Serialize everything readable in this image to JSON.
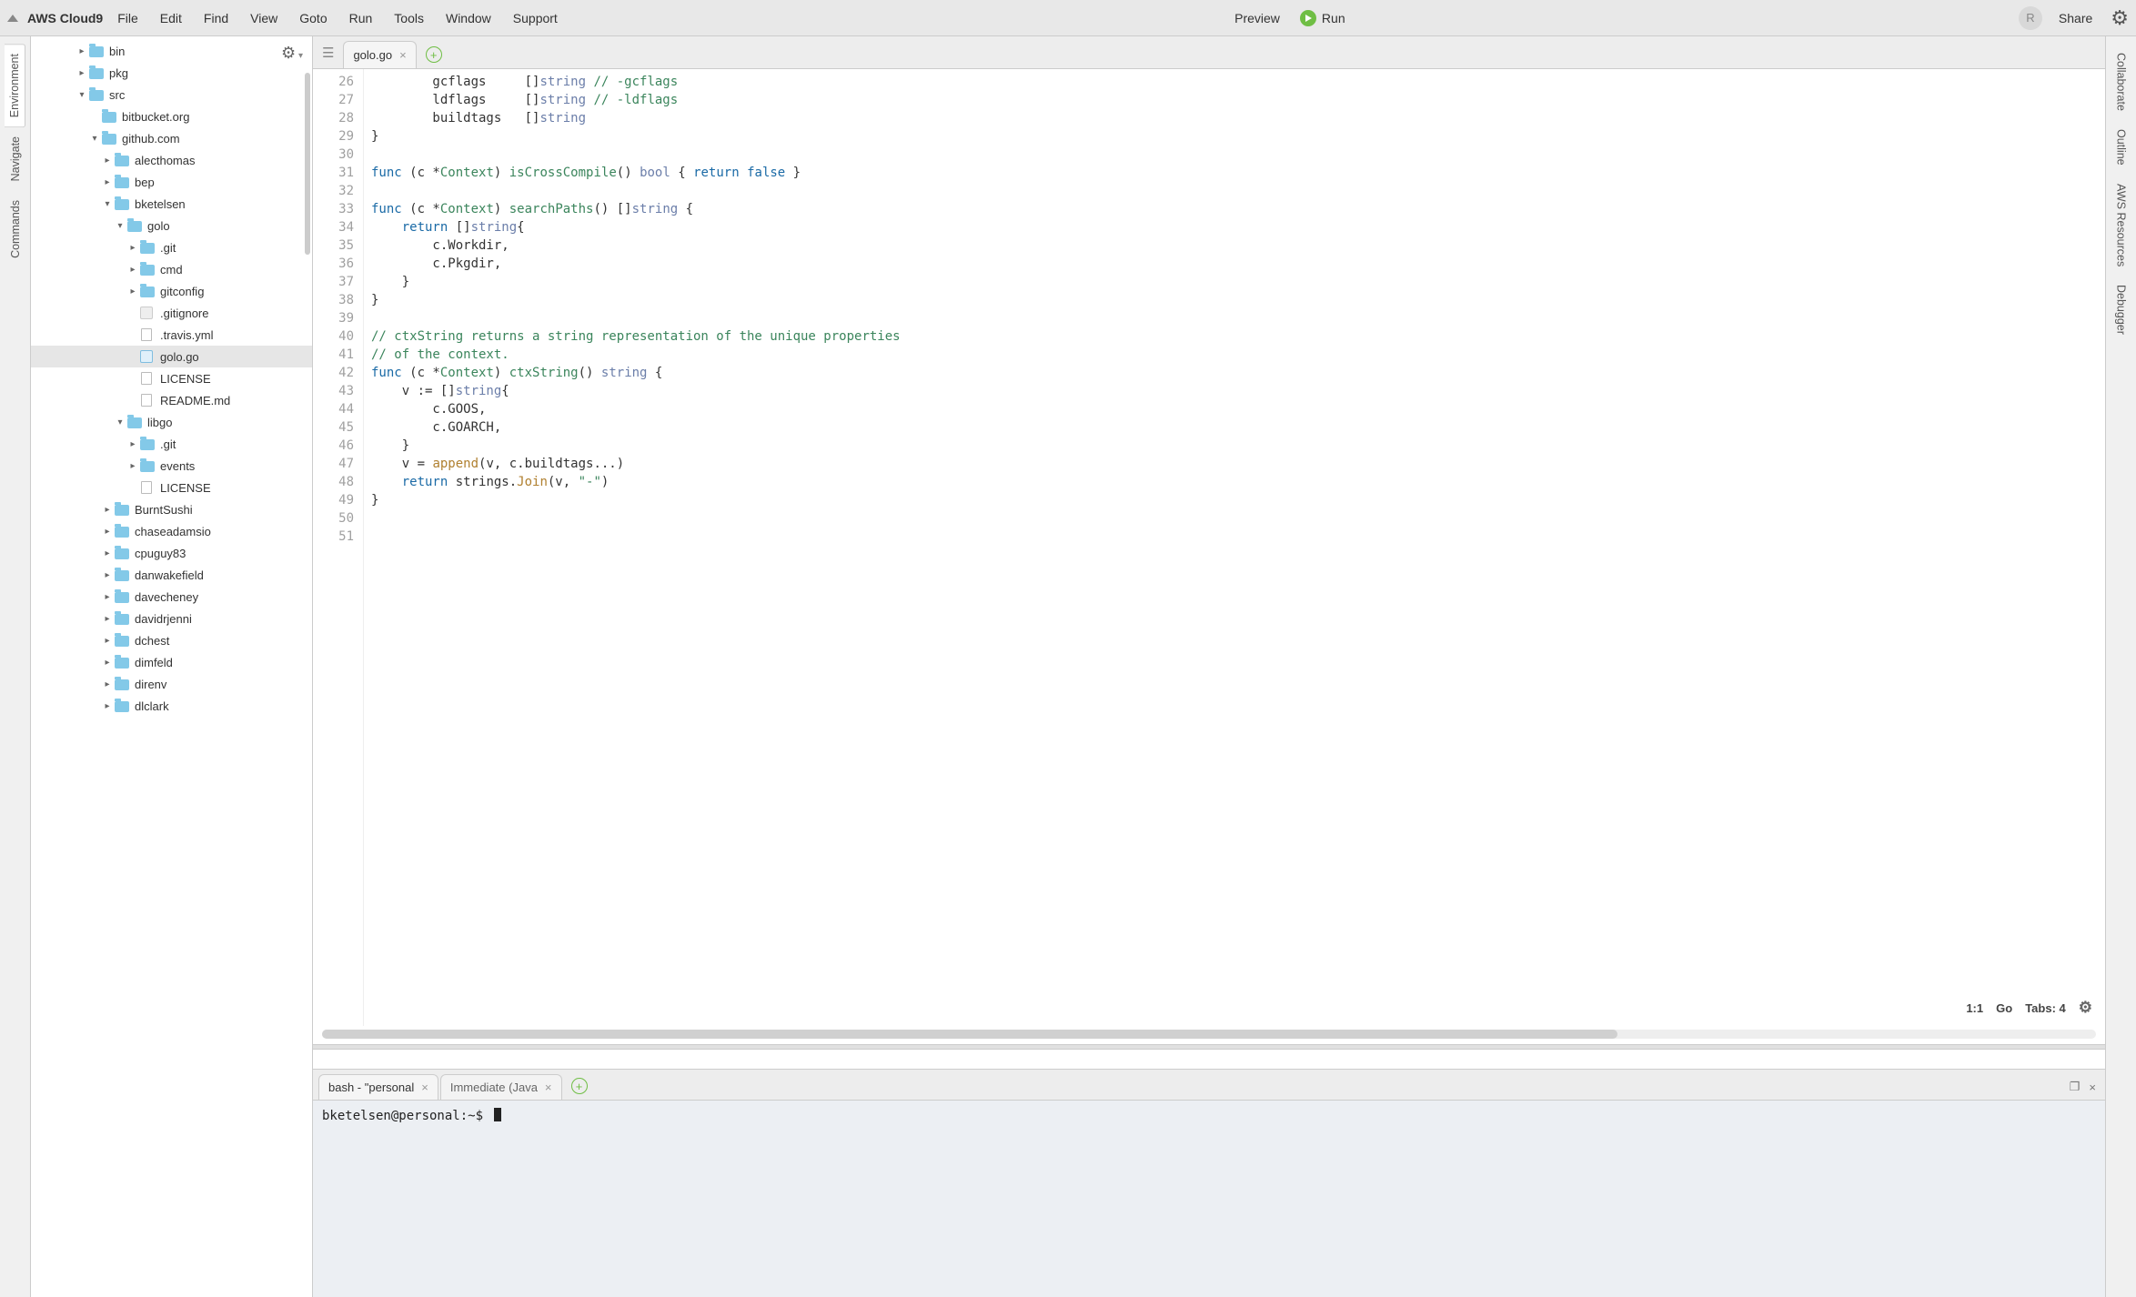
{
  "menubar": {
    "brand": "AWS Cloud9",
    "items": [
      "File",
      "Edit",
      "Find",
      "View",
      "Goto",
      "Run",
      "Tools",
      "Window",
      "Support"
    ],
    "preview": "Preview",
    "run": "Run",
    "avatar_letter": "R",
    "share": "Share"
  },
  "left_rail": [
    "Environment",
    "Navigate",
    "Commands"
  ],
  "right_rail": [
    "Collaborate",
    "Outline",
    "AWS Resources",
    "Debugger"
  ],
  "tree": [
    {
      "depth": 0,
      "type": "folder",
      "chev": "right",
      "label": "bin"
    },
    {
      "depth": 0,
      "type": "folder",
      "chev": "right",
      "label": "pkg"
    },
    {
      "depth": 0,
      "type": "folder",
      "chev": "down",
      "label": "src"
    },
    {
      "depth": 1,
      "type": "folder",
      "chev": "none",
      "label": "bitbucket.org"
    },
    {
      "depth": 1,
      "type": "folder",
      "chev": "down",
      "label": "github.com"
    },
    {
      "depth": 2,
      "type": "folder",
      "chev": "right",
      "label": "alecthomas"
    },
    {
      "depth": 2,
      "type": "folder",
      "chev": "right",
      "label": "bep"
    },
    {
      "depth": 2,
      "type": "folder",
      "chev": "down",
      "label": "bketelsen"
    },
    {
      "depth": 3,
      "type": "folder",
      "chev": "down",
      "label": "golo"
    },
    {
      "depth": 4,
      "type": "folder",
      "chev": "right",
      "label": ".git"
    },
    {
      "depth": 4,
      "type": "folder",
      "chev": "right",
      "label": "cmd"
    },
    {
      "depth": 4,
      "type": "folder",
      "chev": "right",
      "label": "gitconfig"
    },
    {
      "depth": 4,
      "type": "gitig",
      "chev": "none",
      "label": ".gitignore"
    },
    {
      "depth": 4,
      "type": "file",
      "chev": "none",
      "label": ".travis.yml"
    },
    {
      "depth": 4,
      "type": "gofile",
      "chev": "none",
      "label": "golo.go",
      "selected": true
    },
    {
      "depth": 4,
      "type": "file",
      "chev": "none",
      "label": "LICENSE"
    },
    {
      "depth": 4,
      "type": "file",
      "chev": "none",
      "label": "README.md"
    },
    {
      "depth": 3,
      "type": "folder",
      "chev": "down",
      "label": "libgo"
    },
    {
      "depth": 4,
      "type": "folder",
      "chev": "right",
      "label": ".git"
    },
    {
      "depth": 4,
      "type": "folder",
      "chev": "right",
      "label": "events"
    },
    {
      "depth": 4,
      "type": "file",
      "chev": "none",
      "label": "LICENSE"
    },
    {
      "depth": 2,
      "type": "folder",
      "chev": "right",
      "label": "BurntSushi"
    },
    {
      "depth": 2,
      "type": "folder",
      "chev": "right",
      "label": "chaseadamsio"
    },
    {
      "depth": 2,
      "type": "folder",
      "chev": "right",
      "label": "cpuguy83"
    },
    {
      "depth": 2,
      "type": "folder",
      "chev": "right",
      "label": "danwakefield"
    },
    {
      "depth": 2,
      "type": "folder",
      "chev": "right",
      "label": "davecheney"
    },
    {
      "depth": 2,
      "type": "folder",
      "chev": "right",
      "label": "davidrjenni"
    },
    {
      "depth": 2,
      "type": "folder",
      "chev": "right",
      "label": "dchest"
    },
    {
      "depth": 2,
      "type": "folder",
      "chev": "right",
      "label": "dimfeld"
    },
    {
      "depth": 2,
      "type": "folder",
      "chev": "right",
      "label": "direnv"
    },
    {
      "depth": 2,
      "type": "folder",
      "chev": "right",
      "label": "dlclark"
    }
  ],
  "editor": {
    "tab_label": "golo.go",
    "line_start": 26,
    "lines": [
      {
        "n": 26,
        "html": "        gcflags     []<span class='ty'>string</span> <span class='cm'>// -gcflags</span>"
      },
      {
        "n": 27,
        "html": "        ldflags     []<span class='ty'>string</span> <span class='cm'>// -ldflags</span>"
      },
      {
        "n": 28,
        "html": "        buildtags   []<span class='ty'>string</span>"
      },
      {
        "n": 29,
        "html": "}"
      },
      {
        "n": 30,
        "html": ""
      },
      {
        "n": 31,
        "html": "<span class='kw'>func</span> (c *<span class='id'>Context</span>) <span class='id'>isCrossCompile</span>() <span class='ty'>bool</span> { <span class='kw'>return</span> <span class='kw'>false</span> }"
      },
      {
        "n": 32,
        "html": ""
      },
      {
        "n": 33,
        "html": "<span class='kw'>func</span> (c *<span class='id'>Context</span>) <span class='id'>searchPaths</span>() []<span class='ty'>string</span> {"
      },
      {
        "n": 34,
        "html": "    <span class='kw'>return</span> []<span class='ty'>string</span>{"
      },
      {
        "n": 35,
        "html": "        c.Workdir,"
      },
      {
        "n": 36,
        "html": "        c.Pkgdir,"
      },
      {
        "n": 37,
        "html": "    }"
      },
      {
        "n": 38,
        "html": "}"
      },
      {
        "n": 39,
        "html": ""
      },
      {
        "n": 40,
        "html": "<span class='cm'>// ctxString returns a string representation of the unique properties</span>"
      },
      {
        "n": 41,
        "html": "<span class='cm'>// of the context.</span>"
      },
      {
        "n": 42,
        "html": "<span class='kw'>func</span> (c *<span class='id'>Context</span>) <span class='id'>ctxString</span>() <span class='ty'>string</span> {"
      },
      {
        "n": 43,
        "html": "    v := []<span class='ty'>string</span>{"
      },
      {
        "n": 44,
        "html": "        c.GOOS,"
      },
      {
        "n": 45,
        "html": "        c.GOARCH,"
      },
      {
        "n": 46,
        "html": "    }"
      },
      {
        "n": 47,
        "html": "    v = <span class='fn'>append</span>(v, c.buildtags...)"
      },
      {
        "n": 48,
        "html": "    <span class='kw'>return</span> strings.<span class='fn'>Join</span>(v, <span class='cm'>\"-\"</span>)"
      },
      {
        "n": 49,
        "html": "}"
      },
      {
        "n": 50,
        "html": ""
      },
      {
        "n": 51,
        "html": ""
      }
    ],
    "status": {
      "pos": "1:1",
      "lang": "Go",
      "tabs": "Tabs: 4"
    },
    "hscroll_thumb_pct": 73
  },
  "terminal": {
    "tabs": [
      {
        "label": "bash - \"personal",
        "closable": true,
        "active": true
      },
      {
        "label": "Immediate (Java",
        "closable": true,
        "active": false
      }
    ],
    "prompt": "bketelsen@personal:~$ "
  }
}
